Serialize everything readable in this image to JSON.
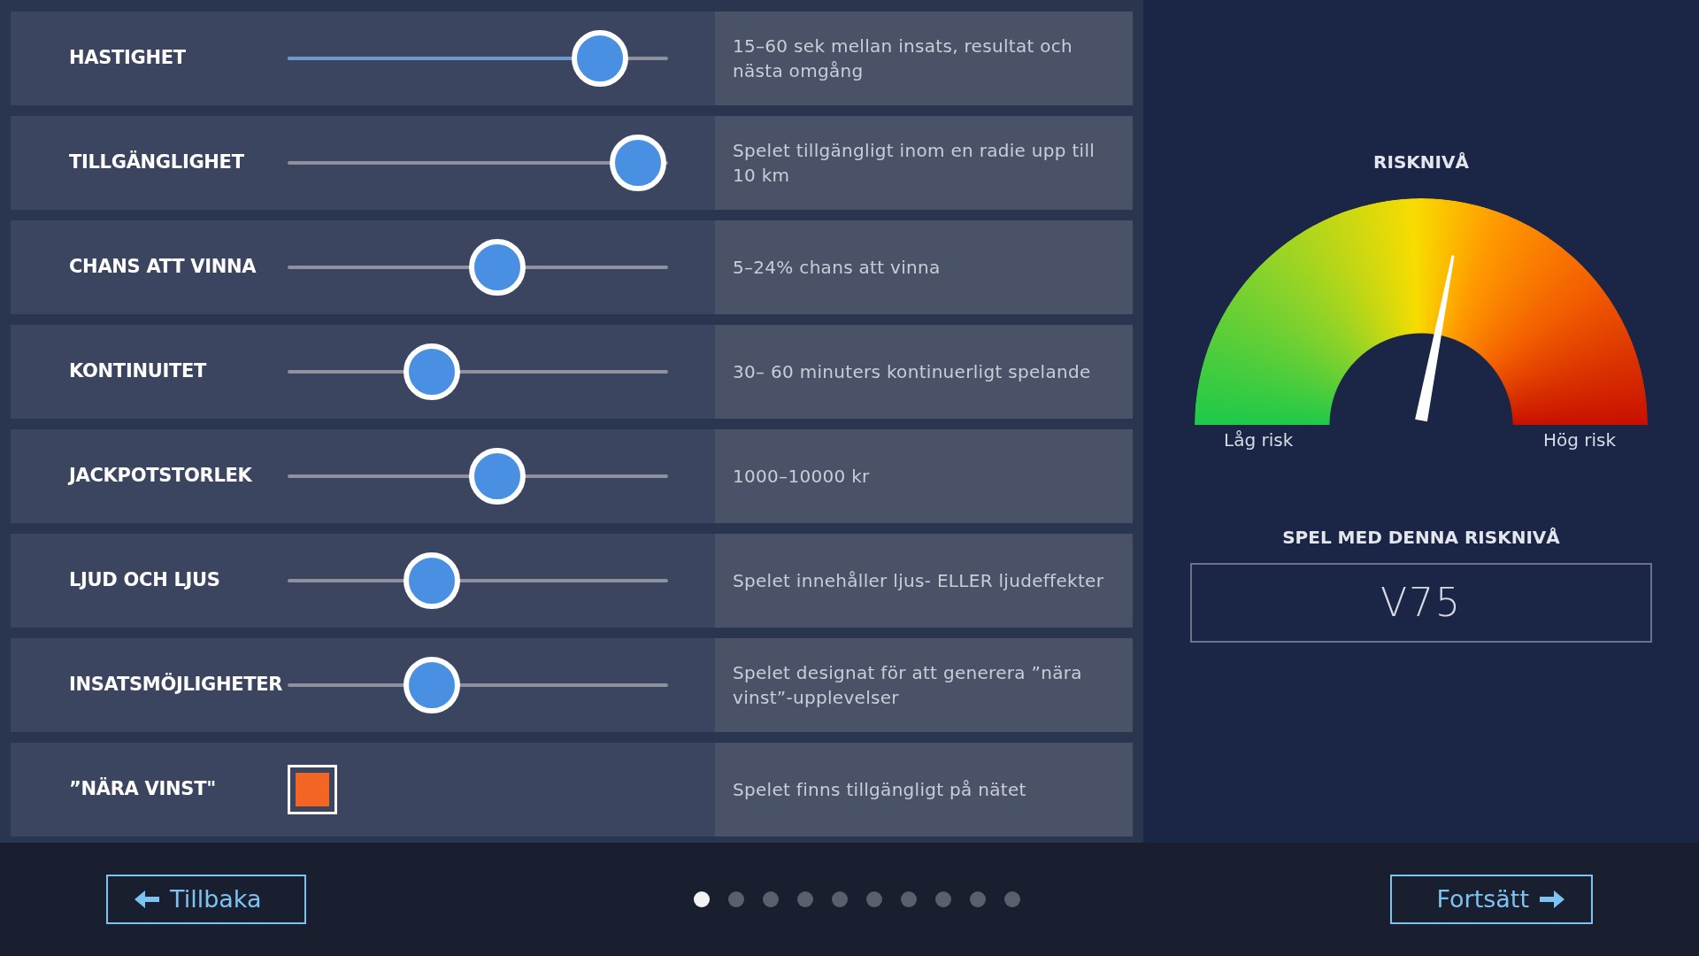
{
  "rows": [
    {
      "kind": "slider",
      "label": "HASTIGHET",
      "level": 0.82,
      "filled": true,
      "description": "15–60 sek mellan insats, resultat och nästa omgång"
    },
    {
      "kind": "slider",
      "label": "TILLGÄNGLIGHET",
      "level": 0.92,
      "filled": false,
      "description": "Spelet tillgängligt inom en radie upp till 10 km"
    },
    {
      "kind": "slider",
      "label": "CHANS ATT VINNA",
      "level": 0.55,
      "filled": false,
      "description": "5–24% chans att vinna"
    },
    {
      "kind": "slider",
      "label": "KONTINUITET",
      "level": 0.38,
      "filled": false,
      "description": "30– 60 minuters kontinuerligt spelande"
    },
    {
      "kind": "slider",
      "label": "JACKPOTSTORLEK",
      "level": 0.55,
      "filled": false,
      "description": "1000–10000 kr"
    },
    {
      "kind": "slider",
      "label": "LJUD OCH LJUS",
      "level": 0.38,
      "filled": false,
      "description": "Spelet innehåller ljus- ELLER ljudeffekter"
    },
    {
      "kind": "slider",
      "label": "INSATSMÖJLIGHETER",
      "level": 0.38,
      "filled": false,
      "description": "Spelet designat för att generera ”nära vinst”-upplevelser"
    },
    {
      "kind": "checkbox",
      "label": "”NÄRA VINST\"",
      "checked": true,
      "description": "Spelet finns tillgängligt på nätet"
    }
  ],
  "gauge": {
    "title": "RISKNIVÅ",
    "level": 0.56,
    "low_label": "Låg risk",
    "high_label": "Hög risk"
  },
  "games": {
    "title": "SPEL MED DENNA RISKNIVÅ",
    "value": "V75"
  },
  "footer": {
    "back": "Tillbaka",
    "next": "Fortsätt",
    "pages": [
      {
        "selected": true
      },
      {
        "selected": false
      },
      {
        "selected": false
      },
      {
        "selected": false
      },
      {
        "selected": false
      },
      {
        "selected": false
      },
      {
        "selected": false
      },
      {
        "selected": false
      },
      {
        "selected": false
      },
      {
        "selected": false
      }
    ]
  }
}
